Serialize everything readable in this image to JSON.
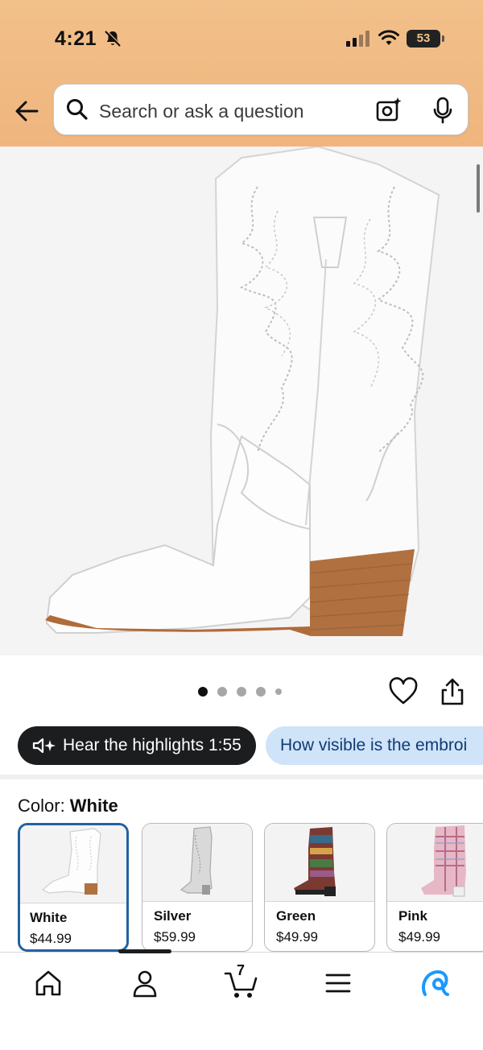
{
  "status_bar": {
    "time": "4:21",
    "battery": "53"
  },
  "search": {
    "placeholder": "Search or ask a question"
  },
  "chips": {
    "hear_highlights": "Hear the highlights 1:55",
    "question": "How visible is the embroi"
  },
  "color": {
    "label": "Color: ",
    "selected": "White",
    "options": [
      {
        "name": "White",
        "price": "$44.99"
      },
      {
        "name": "Silver",
        "price": "$59.99"
      },
      {
        "name": "Green",
        "price": "$49.99"
      },
      {
        "name": "Pink",
        "price": "$49.99"
      }
    ]
  },
  "carousel": {
    "count": 5,
    "active_index": 0
  },
  "nav": {
    "cart_count": "7"
  },
  "colors": {
    "header": "#f2c08a",
    "accent_blue": "#2162a1",
    "chip_dark": "#1b1d1f",
    "chip_light": "#cfe3f9",
    "alexa": "#1a98ff"
  }
}
